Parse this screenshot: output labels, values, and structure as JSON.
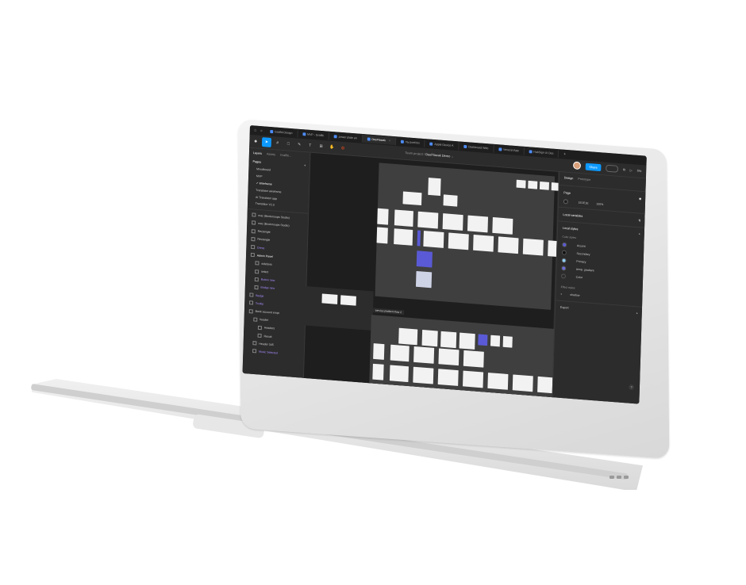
{
  "tabs": [
    {
      "label": "Graffiti Design",
      "active": false
    },
    {
      "label": "MVP - Graffiti",
      "active": false
    },
    {
      "label": "power plate an",
      "active": false
    },
    {
      "label": "DeeFlawak",
      "active": true
    },
    {
      "label": "my portfolio",
      "active": false
    },
    {
      "label": "Apple Device A",
      "active": false
    },
    {
      "label": "Dashboard Web",
      "active": false
    },
    {
      "label": "Venezel App",
      "active": false
    },
    {
      "label": "HubSign UI Des",
      "active": false
    }
  ],
  "breadcrumb": {
    "team": "Team project",
    "separator": "/",
    "file": "DeeFlawak Demo"
  },
  "toolbar": {
    "share_label": "Share",
    "zoom": "5%"
  },
  "left_panel": {
    "tabs": [
      "Layers",
      "Assets",
      "Graffiti..."
    ],
    "pages_title": "Pages",
    "pages": [
      {
        "label": "Moodboard",
        "selected": false
      },
      {
        "label": "MVP",
        "selected": false
      },
      {
        "label": "Wireframe",
        "selected": true
      },
      {
        "label": "Translator wireframe",
        "selected": false
      },
      {
        "label": "AI Translator app",
        "selected": false
      },
      {
        "label": "Translator V2.0",
        "selected": false
      }
    ],
    "layers": [
      {
        "label": "mac (Bookmoups Studio)",
        "style": "normal",
        "level": 0
      },
      {
        "label": "mac (Bookmoups Studio)",
        "style": "normal",
        "level": 0
      },
      {
        "label": "Rectangle",
        "style": "normal",
        "level": 0
      },
      {
        "label": "Rectangle",
        "style": "normal",
        "level": 0
      },
      {
        "label": "Dress",
        "style": "purple",
        "level": 0
      },
      {
        "label": "Admin Panel",
        "style": "bold",
        "level": 0
      },
      {
        "label": "sidebars",
        "style": "normal",
        "level": 1
      },
      {
        "label": "select",
        "style": "normal",
        "level": 1
      },
      {
        "label": "Button new",
        "style": "purple",
        "level": 1
      },
      {
        "label": "Badge new",
        "style": "purple",
        "level": 1
      },
      {
        "label": "Badge",
        "style": "purple",
        "level": 0
      },
      {
        "label": "Tooltip",
        "style": "purple",
        "level": 0
      },
      {
        "label": "Bank account empt",
        "style": "normal",
        "level": 0
      },
      {
        "label": "header",
        "style": "normal",
        "level": 1
      },
      {
        "label": "Headers",
        "style": "normal",
        "level": 2
      },
      {
        "label": "Result",
        "style": "normal",
        "level": 2
      },
      {
        "label": "Header 345",
        "style": "normal",
        "level": 1
      },
      {
        "label": "Music Selected",
        "style": "purple",
        "level": 1
      }
    ]
  },
  "canvas": {
    "flow_label": "service platform flow 2"
  },
  "right_panel": {
    "tabs": [
      "Design",
      "Prototype"
    ],
    "page_title": "Page",
    "page_color": "1E1E1E",
    "page_opacity": "100%",
    "local_variables": "Local variables",
    "local_styles": "Local styles",
    "color_styles_title": "Color styles",
    "color_styles": [
      {
        "label": "Accent",
        "color": "#5b5bd6"
      },
      {
        "label": "Secondary",
        "color": "#111111"
      },
      {
        "label": "Primary",
        "color": "#8ecdf0"
      },
      {
        "label": "temp. gradient",
        "color": "#6b6bd6"
      },
      {
        "label": "Color",
        "color": "#2c2c2c"
      }
    ],
    "effect_styles_title": "Effect styles",
    "effect_styles": [
      {
        "label": "shadow"
      }
    ],
    "export_title": "Export",
    "help": "?"
  }
}
